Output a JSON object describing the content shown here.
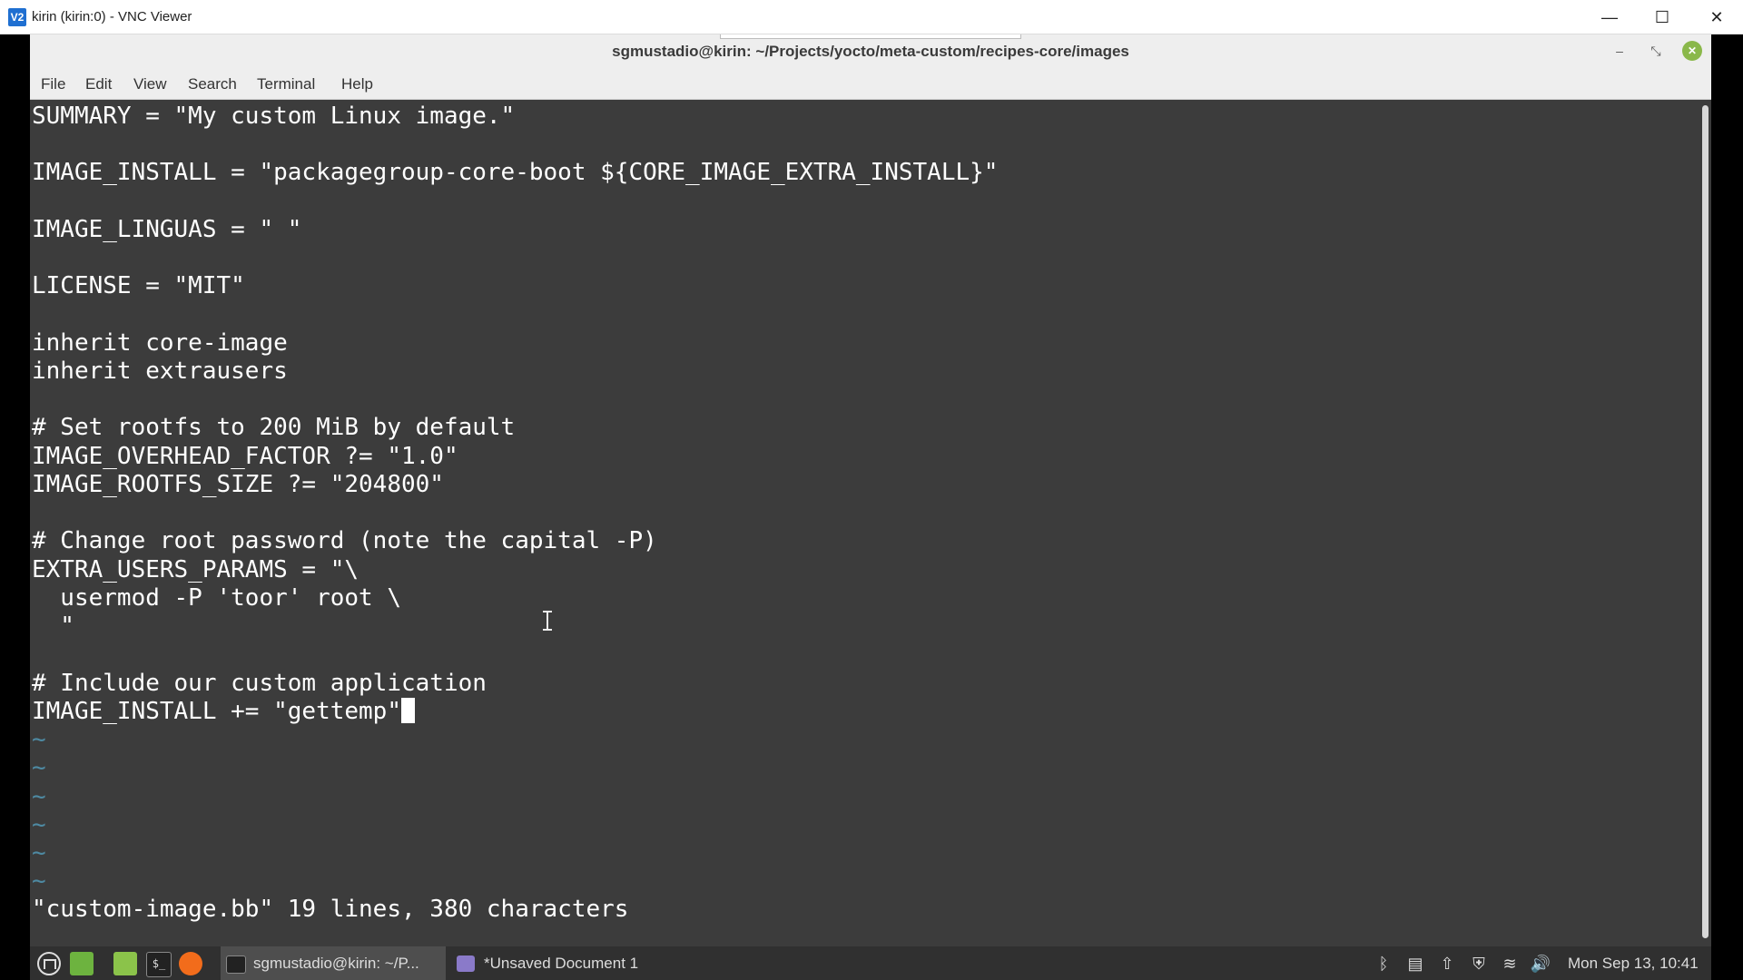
{
  "vnc": {
    "logo": "V2",
    "title": "kirin (kirin:0) - VNC Viewer",
    "controls": {
      "minimize": "—",
      "maximize": "☐",
      "close": "✕"
    }
  },
  "terminal": {
    "title": "sgmustadio@kirin: ~/Projects/yocto/meta-custom/recipes-core/images",
    "controls": {
      "minimize": "–",
      "restore": "⤡",
      "close": "✕"
    },
    "menu": [
      "File",
      "Edit",
      "View",
      "Search",
      "Terminal",
      "Help"
    ],
    "lines": [
      "SUMMARY = \"My custom Linux image.\"",
      "",
      "IMAGE_INSTALL = \"packagegroup-core-boot ${CORE_IMAGE_EXTRA_INSTALL}\"",
      "",
      "IMAGE_LINGUAS = \" \"",
      "",
      "LICENSE = \"MIT\"",
      "",
      "inherit core-image",
      "inherit extrausers",
      "",
      "# Set rootfs to 200 MiB by default",
      "IMAGE_OVERHEAD_FACTOR ?= \"1.0\"",
      "IMAGE_ROOTFS_SIZE ?= \"204800\"",
      "",
      "# Change root password (note the capital -P)",
      "EXTRA_USERS_PARAMS = \"\\",
      "  usermod -P 'toor' root \\",
      "  \"",
      "",
      "# Include our custom application",
      "IMAGE_INSTALL += \"gettemp\""
    ],
    "tildes": [
      "~",
      "~",
      "~",
      "~",
      "~",
      "~"
    ],
    "status_line": "\"custom-image.bb\" 19 lines, 380 characters"
  },
  "taskbar": {
    "terminal_icon_glyph": "$_",
    "tasks": [
      {
        "label": "sgmustadio@kirin: ~/P..."
      },
      {
        "label": "*Unsaved Document 1"
      }
    ],
    "tray": {
      "bluetooth": "ᛒ",
      "clipboard": "▤",
      "update": "⇧",
      "shield": "⛨",
      "wifi": "≋",
      "volume": "🔊"
    },
    "clock": "Mon Sep 13, 10:41"
  }
}
